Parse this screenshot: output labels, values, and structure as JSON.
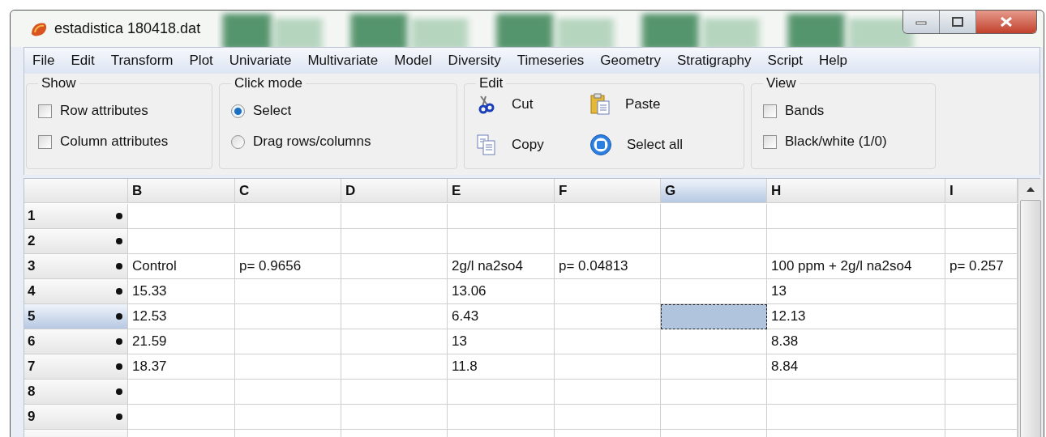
{
  "window": {
    "title": "estadistica 180418.dat"
  },
  "menu": [
    "File",
    "Edit",
    "Transform",
    "Plot",
    "Univariate",
    "Multivariate",
    "Model",
    "Diversity",
    "Timeseries",
    "Geometry",
    "Stratigraphy",
    "Script",
    "Help"
  ],
  "show": {
    "title": "Show",
    "options": [
      {
        "label": "Row attributes",
        "checked": false
      },
      {
        "label": "Column attributes",
        "checked": false
      }
    ]
  },
  "click_mode": {
    "title": "Click mode",
    "options": [
      {
        "label": "Select",
        "selected": true
      },
      {
        "label": "Drag rows/columns",
        "selected": false
      }
    ]
  },
  "edit": {
    "title": "Edit",
    "actions": [
      {
        "label": "Cut",
        "kind": "cut"
      },
      {
        "label": "Paste",
        "kind": "paste"
      },
      {
        "label": "Copy",
        "kind": "copy"
      },
      {
        "label": "Select all",
        "kind": "selectall"
      }
    ]
  },
  "view": {
    "title": "View",
    "options": [
      {
        "label": "Bands",
        "checked": false
      },
      {
        "label": "Black/white (1/0)",
        "checked": false
      }
    ]
  },
  "table": {
    "columns": [
      {
        "label": "B",
        "selected": false
      },
      {
        "label": "C",
        "selected": false
      },
      {
        "label": "D",
        "selected": false
      },
      {
        "label": "E",
        "selected": false
      },
      {
        "label": "F",
        "selected": false
      },
      {
        "label": "G",
        "selected": true
      },
      {
        "label": "H",
        "selected": false
      },
      {
        "label": "I",
        "selected": false
      }
    ],
    "rows": [
      {
        "label": "1",
        "selected": false,
        "cells": {}
      },
      {
        "label": "2",
        "selected": false,
        "cells": {}
      },
      {
        "label": "3",
        "selected": false,
        "cells": {
          "B": "Control",
          "C": "p= 0.9656",
          "E": "2g/l na2so4",
          "F": "p= 0.04813",
          "H": "100 ppm + 2g/l na2so4",
          "I": "p= 0.257"
        }
      },
      {
        "label": "4",
        "selected": false,
        "cells": {
          "B": "15.33",
          "E": "13.06",
          "H": "13"
        }
      },
      {
        "label": "5",
        "selected": true,
        "cells": {
          "B": "12.53",
          "E": "6.43",
          "H": "12.13"
        }
      },
      {
        "label": "6",
        "selected": false,
        "cells": {
          "B": "21.59",
          "E": "13",
          "H": "8.38"
        }
      },
      {
        "label": "7",
        "selected": false,
        "cells": {
          "B": "18.37",
          "E": "11.8",
          "H": "8.84"
        }
      },
      {
        "label": "8",
        "selected": false,
        "cells": {}
      },
      {
        "label": "9",
        "selected": false,
        "cells": {}
      }
    ]
  }
}
